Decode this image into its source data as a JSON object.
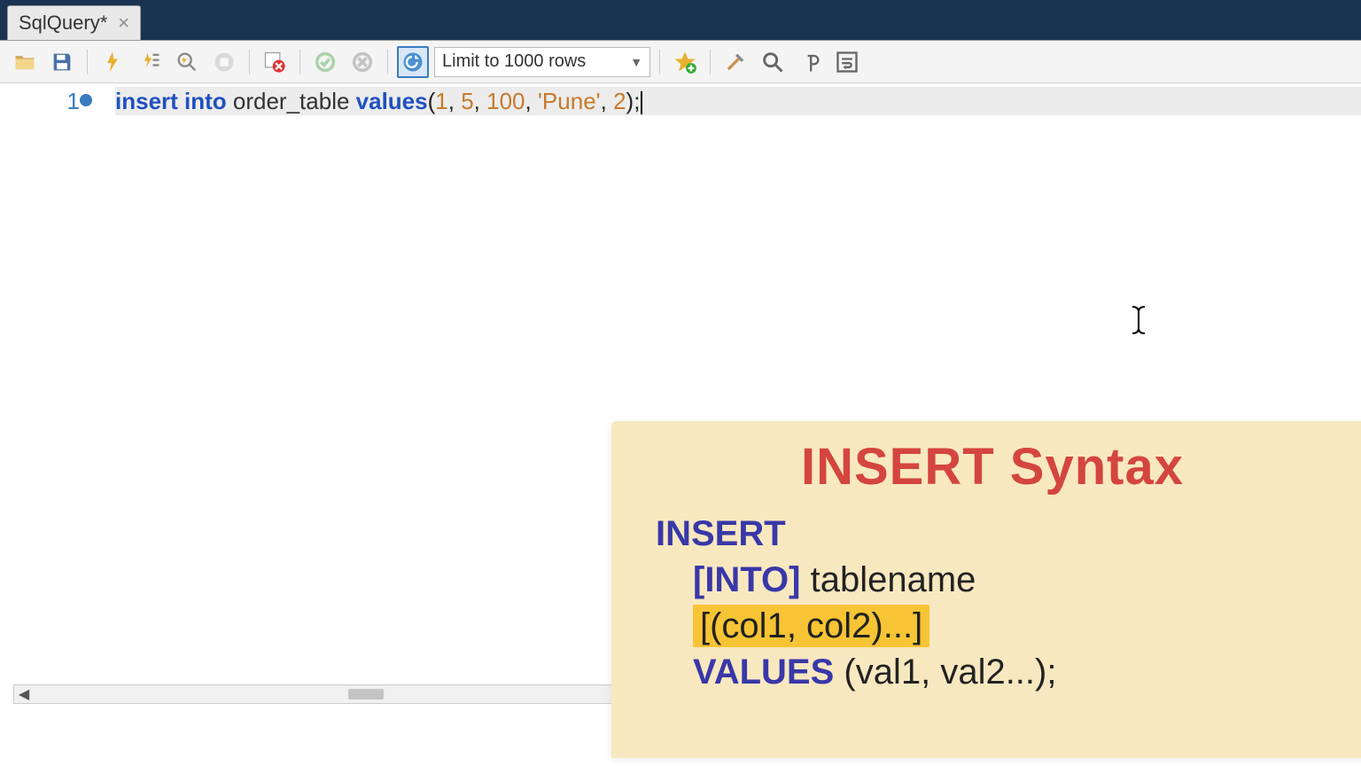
{
  "tab": {
    "title": "SqlQuery*",
    "close_icon": "×"
  },
  "toolbar": {
    "row_limit_label": "Limit to 1000 rows"
  },
  "editor": {
    "line_no": "1",
    "code": {
      "k1": "insert into",
      "id1": " order_table ",
      "k2": "values",
      "paren_open": "(",
      "n1": "1",
      "c1": ", ",
      "n2": "5",
      "c2": ", ",
      "n3": "100",
      "c3": ", ",
      "s1": "'Pune'",
      "c4": ", ",
      "n4": "2",
      "paren_close": ")",
      "semicolon": ";"
    }
  },
  "overlay": {
    "title": "INSERT Syntax",
    "l1_kw": "INSERT",
    "l2_kw": "[INTO]",
    "l2_text": " tablename",
    "l3_hl": "[(col1, col2)...]",
    "l4_kw": "VALUES ",
    "l4_text": "(val1, val2...);"
  }
}
